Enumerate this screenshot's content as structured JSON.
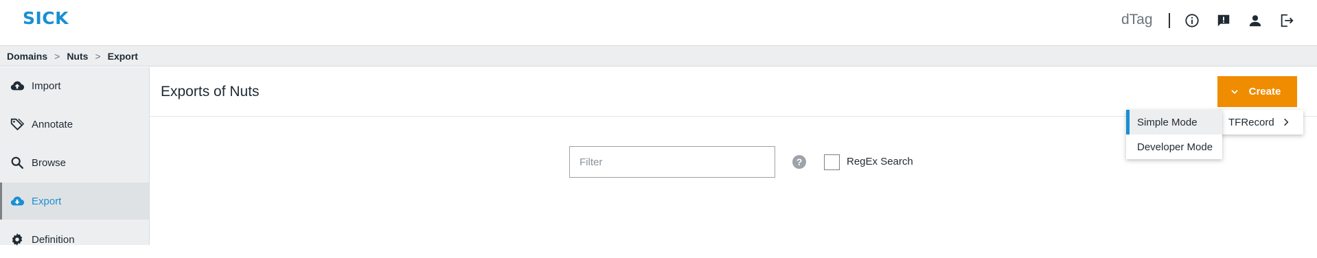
{
  "brand": {
    "logo": "SICK",
    "app_name": "dTag",
    "accent": "#1a8fd2",
    "create_color": "#f08c00"
  },
  "header_icons": [
    "info-icon",
    "feedback-icon",
    "user-icon",
    "logout-icon"
  ],
  "breadcrumb": {
    "items": [
      "Domains",
      "Nuts",
      "Export"
    ],
    "separator": ">"
  },
  "sidebar": {
    "items": [
      {
        "label": "Import",
        "icon": "cloud-upload-icon"
      },
      {
        "label": "Annotate",
        "icon": "tag-icon"
      },
      {
        "label": "Browse",
        "icon": "search-icon"
      },
      {
        "label": "Export",
        "icon": "cloud-download-icon",
        "active": true
      },
      {
        "label": "Definition",
        "icon": "gear-icon"
      }
    ]
  },
  "main": {
    "title": "Exports of Nuts",
    "create_label": "Create",
    "filter_placeholder": "Filter",
    "help_glyph": "?",
    "regex_label": "RegEx Search",
    "regex_checked": false
  },
  "dropdown": {
    "format_label": "TFRecord",
    "modes": [
      {
        "label": "Simple Mode",
        "selected": true
      },
      {
        "label": "Developer Mode",
        "selected": false
      }
    ]
  }
}
